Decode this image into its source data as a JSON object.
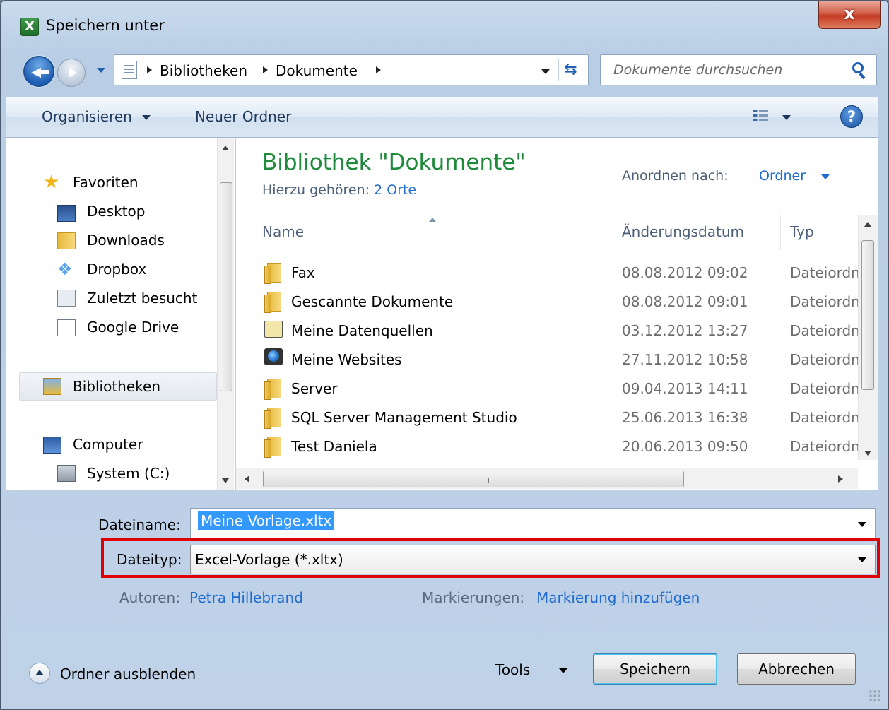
{
  "window": {
    "title": "Speichern unter",
    "app_icon": "excel-icon",
    "close_glyph": "x"
  },
  "address": {
    "crumbs": [
      "Bibliotheken",
      "Dokumente"
    ]
  },
  "search": {
    "placeholder": "Dokumente durchsuchen"
  },
  "toolbar": {
    "organize_label": "Organisieren",
    "new_folder_label": "Neuer Ordner",
    "help_glyph": "?"
  },
  "nav": {
    "favorites": "Favoriten",
    "desktop": "Desktop",
    "downloads": "Downloads",
    "dropbox": "Dropbox",
    "recent": "Zuletzt besucht",
    "gdrive": "Google Drive",
    "libraries": "Bibliotheken",
    "computer": "Computer",
    "system": "System (C:)"
  },
  "library": {
    "title": "Bibliothek \"Dokumente\"",
    "includes_label": "Hierzu gehören:",
    "includes_link": "2 Orte",
    "arrange_label": "Anordnen nach:",
    "arrange_value": "Ordner"
  },
  "columns": {
    "name": "Name",
    "date": "Änderungsdatum",
    "type": "Typ"
  },
  "files": [
    {
      "name": "Fax",
      "date": "08.08.2012 09:02",
      "type": "Dateiordner",
      "icon": "folder-icon"
    },
    {
      "name": "Gescannte Dokumente",
      "date": "08.08.2012 09:01",
      "type": "Dateiordner",
      "icon": "folder-icon"
    },
    {
      "name": "Meine Datenquellen",
      "date": "03.12.2012 13:27",
      "type": "Dateiordner",
      "icon": "datasource-folder-icon"
    },
    {
      "name": "Meine Websites",
      "date": "27.11.2012 10:58",
      "type": "Dateiordner",
      "icon": "web-folder-icon"
    },
    {
      "name": "Server",
      "date": "09.04.2013 14:11",
      "type": "Dateiordner",
      "icon": "folder-icon"
    },
    {
      "name": "SQL Server Management Studio",
      "date": "25.06.2013 16:38",
      "type": "Dateiordner",
      "icon": "folder-icon"
    },
    {
      "name": "Test Daniela",
      "date": "20.06.2013 09:50",
      "type": "Dateiordner",
      "icon": "folder-icon"
    }
  ],
  "form": {
    "filename_label": "Dateiname:",
    "filename_value": "Meine Vorlage.xltx",
    "filetype_label": "Dateityp:",
    "filetype_value": "Excel-Vorlage (*.xltx)",
    "authors_label": "Autoren:",
    "authors_value": "Petra Hillebrand",
    "tags_label": "Markierungen:",
    "tags_value": "Markierung hinzufügen"
  },
  "footer": {
    "hide_folders": "Ordner ausblenden",
    "tools": "Tools",
    "save": "Speichern",
    "cancel": "Abbrechen"
  },
  "colors": {
    "highlight": "#e00000",
    "library_title": "#1e8a3b",
    "link": "#1f6bd0"
  }
}
